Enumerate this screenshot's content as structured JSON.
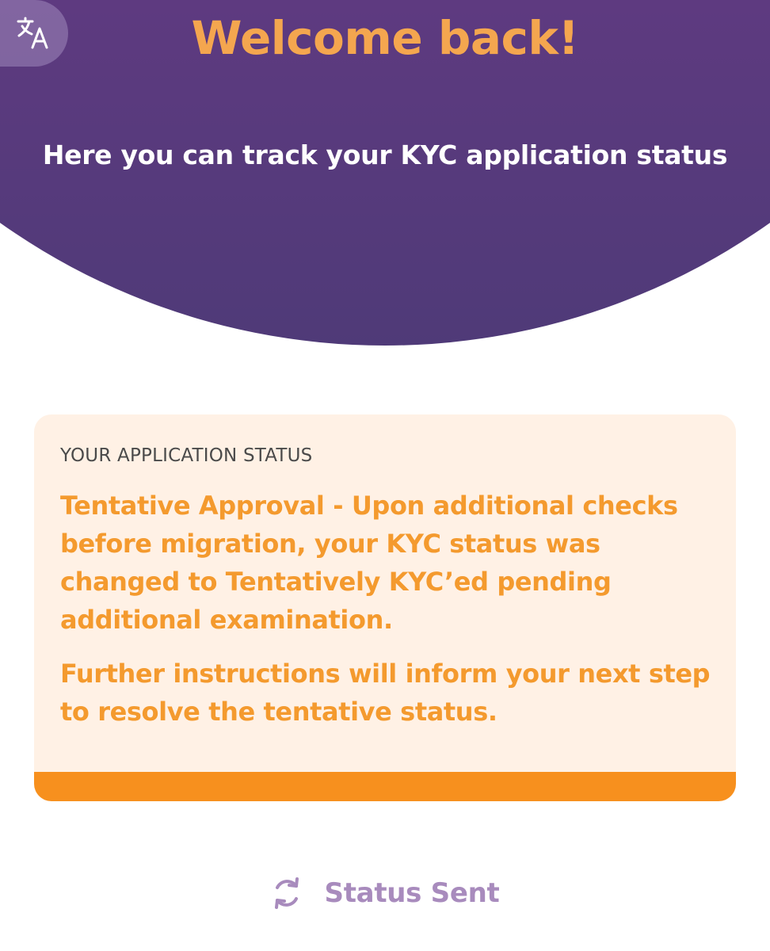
{
  "header": {
    "title": "Welcome back!",
    "subtitle": "Here you can track your KYC application status",
    "language_icon": "translate-icon"
  },
  "status_card": {
    "heading": "YOUR APPLICATION STATUS",
    "message": "Tentative Approval - Upon additional checks before migration, your KYC status was changed to Tentatively KYC’ed pending additional examination.",
    "instructions": "Further instructions will inform your next step to resolve the tentative status."
  },
  "footer_status": {
    "label": "Status Sent",
    "icon": "refresh-icon"
  },
  "colors": {
    "header_background": "#5e3a80",
    "title_accent": "#f4a64f",
    "card_background": "#fff1e5",
    "status_text": "#f49a2e",
    "card_bar": "#f7901e",
    "status_sent": "#a88bbd"
  }
}
